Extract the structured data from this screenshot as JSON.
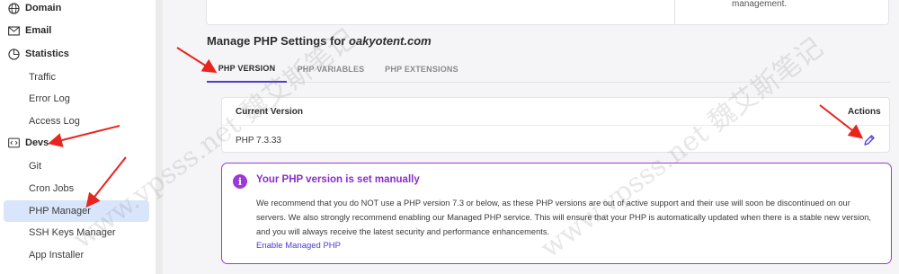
{
  "sidebar": {
    "domain": "Domain",
    "email": "Email",
    "statistics": "Statistics",
    "traffic": "Traffic",
    "error_log": "Error Log",
    "access_log": "Access Log",
    "devs": "Devs",
    "git": "Git",
    "cron_jobs": "Cron Jobs",
    "php_manager": "PHP Manager",
    "ssh_keys_manager": "SSH Keys Manager",
    "app_installer": "App Installer"
  },
  "top_card": {
    "note": "management."
  },
  "page": {
    "title_prefix": "Manage PHP Settings for ",
    "domain": "oakyotent.com"
  },
  "tabs": [
    "PHP VERSION",
    "PHP VARIABLES",
    "PHP EXTENSIONS"
  ],
  "version_card": {
    "current_version_header": "Current Version",
    "actions_header": "Actions",
    "current_version": "PHP 7.3.33"
  },
  "alert": {
    "title": "Your PHP version is set manually",
    "body": "We recommend that you do NOT use a PHP version 7.3 or below, as these PHP versions are out of active support and their use will soon be discontinued on our servers. We also strongly recommend enabling our Managed PHP service. This will ensure that your PHP is automatically updated when there is a stable new version, and you will always receive the latest security and performance enhancements.",
    "link": "Enable Managed PHP"
  },
  "watermark": "www.vpsss.net 魏艾斯笔记",
  "colors": {
    "accent": "#4a3cd6",
    "alert": "#9a3ad8",
    "active_nav": "#d8e5fb",
    "arrow": "#e8241f"
  }
}
